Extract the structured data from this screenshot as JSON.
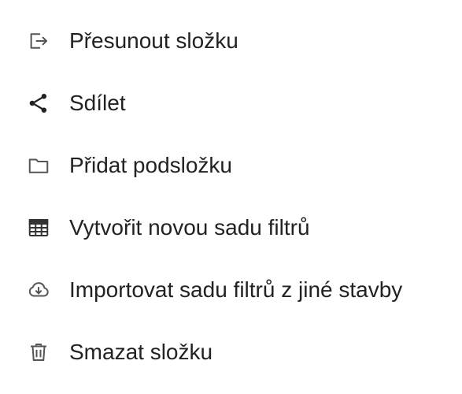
{
  "menu": {
    "items": [
      {
        "label": "Přesunout složku",
        "icon": "move-folder-icon"
      },
      {
        "label": "Sdílet",
        "icon": "share-icon"
      },
      {
        "label": "Přidat podsložku",
        "icon": "folder-icon"
      },
      {
        "label": "Vytvořit novou sadu filtrů",
        "icon": "table-icon"
      },
      {
        "label": "Importovat sadu filtrů z jiné stavby",
        "icon": "cloud-download-icon"
      },
      {
        "label": "Smazat složku",
        "icon": "trash-icon"
      }
    ]
  },
  "colors": {
    "text": "#222222",
    "icon": "#555555"
  }
}
